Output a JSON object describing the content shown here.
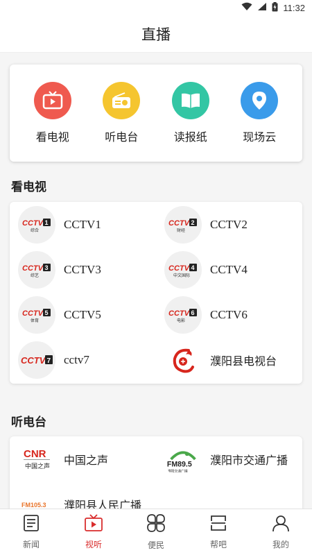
{
  "status_bar": {
    "time": "11:32"
  },
  "header": {
    "title": "直播"
  },
  "quick_menu": [
    {
      "label": "看电视",
      "color": "#ef5a4f",
      "icon": "tv-play-icon"
    },
    {
      "label": "听电台",
      "color": "#f5c52f",
      "icon": "radio-icon"
    },
    {
      "label": "读报纸",
      "color": "#33c6a4",
      "icon": "book-icon"
    },
    {
      "label": "现场云",
      "color": "#3a9bea",
      "icon": "location-pin-icon"
    }
  ],
  "tv_section": {
    "title": "看电视",
    "channels": [
      {
        "name": "CCTV1",
        "badge": "1",
        "sub": "综合"
      },
      {
        "name": "CCTV2",
        "badge": "2",
        "sub": "财经"
      },
      {
        "name": "CCTV3",
        "badge": "3",
        "sub": "综艺"
      },
      {
        "name": "CCTV4",
        "badge": "4",
        "sub": "中文国际"
      },
      {
        "name": "CCTV5",
        "badge": "5",
        "sub": "体育"
      },
      {
        "name": "CCTV6",
        "badge": "6",
        "sub": "电影"
      },
      {
        "name": "cctv7",
        "badge": "7",
        "sub": ""
      },
      {
        "name": "濮阳县电视台",
        "badge": "",
        "sub": ""
      }
    ]
  },
  "radio_section": {
    "title": "听电台",
    "stations": [
      {
        "name": "中国之声",
        "logo_text": "CNR",
        "logo_sub": "中国之声"
      },
      {
        "name": "濮阳市交通广播",
        "logo_text": "FM89.5",
        "logo_sub": "濮阳交通广播"
      },
      {
        "name": "濮阳县人民广播",
        "logo_text": "FM105.3",
        "logo_sub": ""
      }
    ]
  },
  "tab_bar": [
    {
      "label": "新闻",
      "active": false
    },
    {
      "label": "视听",
      "active": true
    },
    {
      "label": "便民",
      "active": false
    },
    {
      "label": "帮吧",
      "active": false
    },
    {
      "label": "我的",
      "active": false
    }
  ],
  "colors": {
    "accent": "#d92d2d",
    "cctv_red": "#d7261d"
  }
}
